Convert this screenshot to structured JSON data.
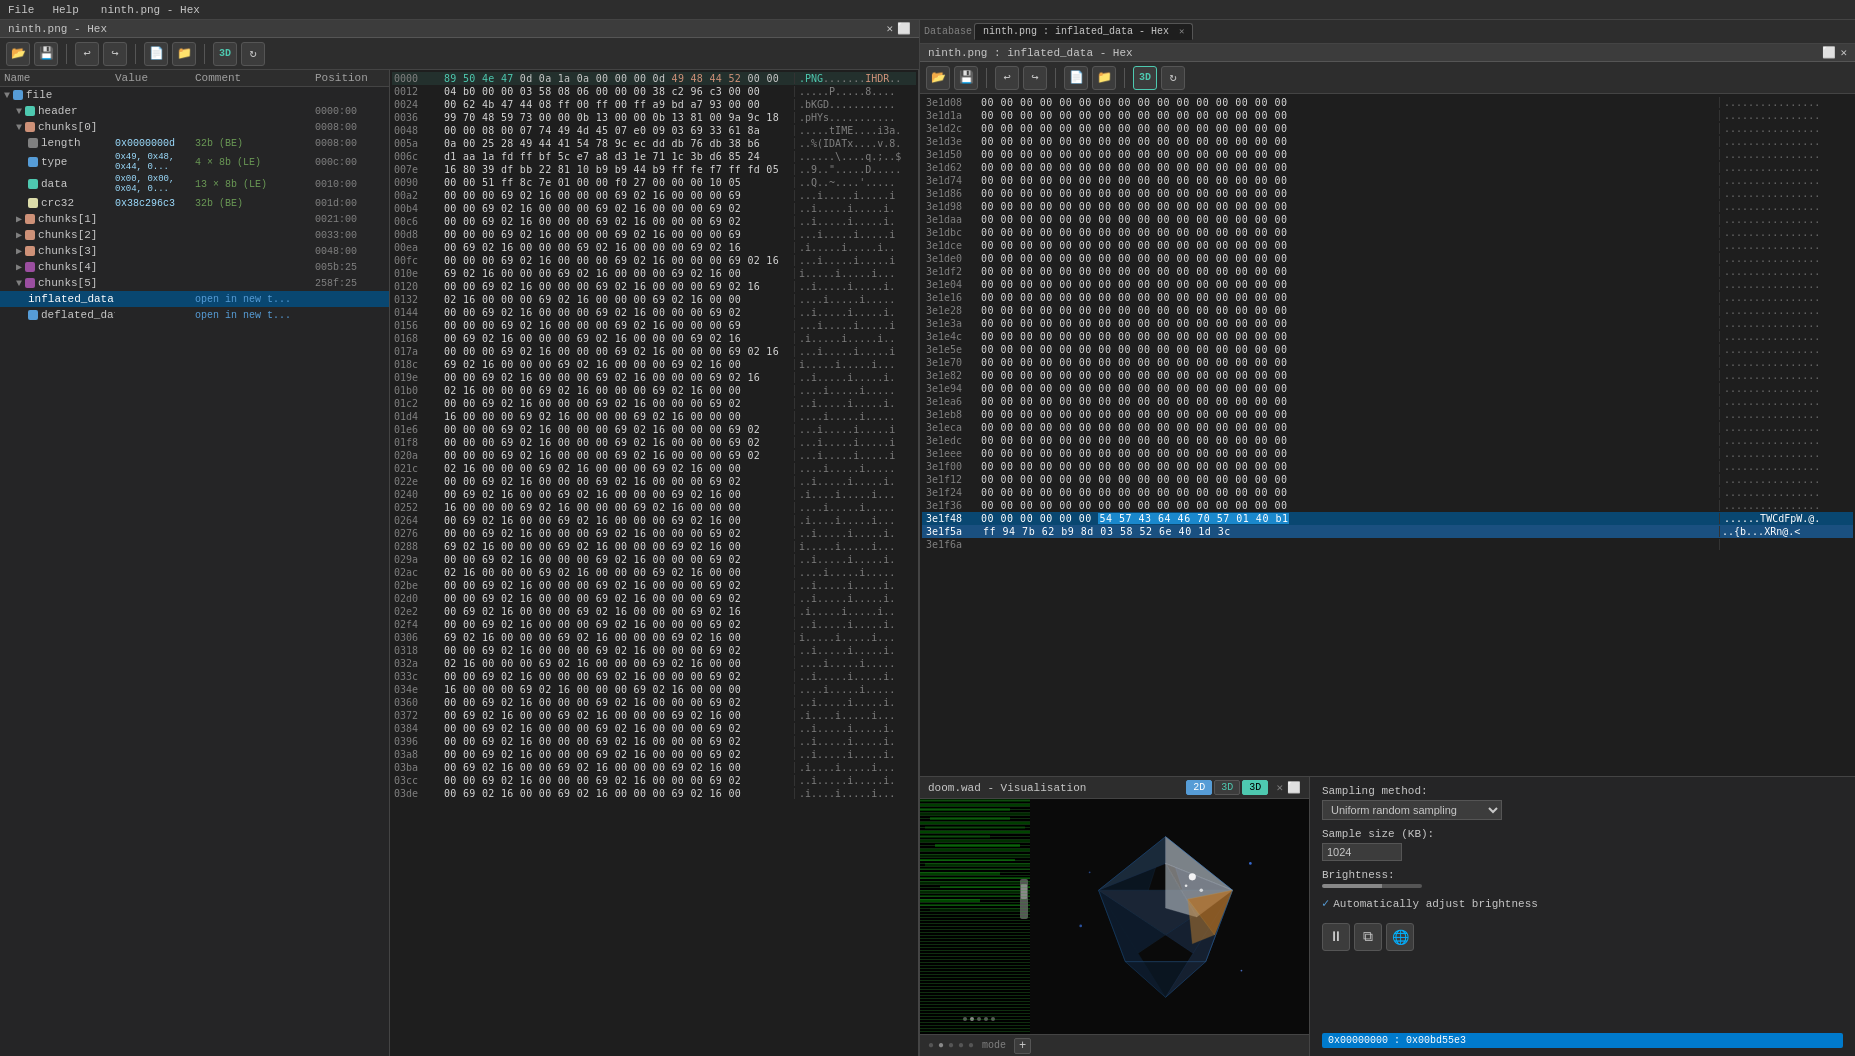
{
  "app": {
    "title": "ninth.png - Hex",
    "menu": [
      "File",
      "Help"
    ]
  },
  "main_window": {
    "title": "ninth.png - Hex",
    "tabs": [
      {
        "label": "ninth.png : inflated_data - Hex",
        "active": true,
        "closeable": true
      },
      {
        "label": "ninth.png : inflated_data - Hex",
        "active": true
      }
    ]
  },
  "toolbar": {
    "buttons": [
      "open",
      "save",
      "back",
      "forward",
      "open-file",
      "open-folder",
      "3d",
      "refresh"
    ]
  },
  "left_panel": {
    "columns": [
      "Name",
      "Value",
      "Comment",
      "Position"
    ],
    "tree": [
      {
        "indent": 0,
        "expanded": true,
        "icon": "file",
        "label": "file",
        "value": "",
        "comment": "",
        "position": ""
      },
      {
        "indent": 1,
        "expanded": true,
        "icon": "folder",
        "label": "header",
        "value": "",
        "comment": "",
        "position": "0000:00"
      },
      {
        "indent": 1,
        "expanded": true,
        "icon": "folder",
        "label": "chunks[0]",
        "value": "",
        "comment": "",
        "position": "0008:00"
      },
      {
        "indent": 2,
        "label": "length",
        "value": "0x0000000d",
        "comment": "32b (BE)",
        "position": "0008:00"
      },
      {
        "indent": 2,
        "label": "type",
        "value": "0x49, 0x48, 0x44, 0...",
        "comment": "4 × 8b (LE)",
        "position": "000c:00"
      },
      {
        "indent": 2,
        "label": "data",
        "value": "0x00, 0x00, 0x04, 0...",
        "comment": "13 × 8b (LE)",
        "position": "0010:00"
      },
      {
        "indent": 2,
        "label": "crc32",
        "value": "0x38c296c3",
        "comment": "32b (BE)",
        "position": "001d:00"
      },
      {
        "indent": 1,
        "expanded": false,
        "icon": "folder",
        "label": "chunks[1]",
        "value": "",
        "comment": "",
        "position": "0021:00"
      },
      {
        "indent": 1,
        "expanded": false,
        "icon": "folder",
        "label": "chunks[2]",
        "value": "",
        "comment": "",
        "position": "0033:00"
      },
      {
        "indent": 1,
        "expanded": false,
        "icon": "folder",
        "label": "chunks[3]",
        "value": "",
        "comment": "",
        "position": "0048:00"
      },
      {
        "indent": 1,
        "expanded": false,
        "icon": "folder",
        "label": "chunks[4]",
        "value": "",
        "comment": "",
        "position": "005b:25"
      },
      {
        "indent": 1,
        "expanded": false,
        "icon": "folder",
        "label": "chunks[5]",
        "value": "",
        "comment": "",
        "position": "258f:25"
      },
      {
        "indent": 2,
        "label": "inflated_data",
        "value": "",
        "comment": "open in new t...",
        "position": "",
        "selected": true
      },
      {
        "indent": 2,
        "label": "deflated_data",
        "value": "",
        "comment": "open in new t...",
        "position": ""
      }
    ]
  },
  "hex_panel": {
    "title": "ninth.png - Hex",
    "rows": [
      {
        "addr": "0000",
        "bytes": "89 50 4e 47 0d 0a 1a 0a 00 00 00 0d 49 48 44 52 00 00",
        "ascii": ""
      },
      {
        "addr": "0012",
        "bytes": "04 b0 00 00 03 58 08 06 00 00 00 38 c2 96 c3 00 00",
        "ascii": ""
      },
      {
        "addr": "0024",
        "bytes": "00 62 4b 47 44 08 ff 00 ff 00 ff a9 bd a7 93 00 00",
        "ascii": ""
      },
      {
        "addr": "0036",
        "bytes": "99 70 48 59 73 00 00 0b 13 00 00 0b 13 81 00 9a 9c 18",
        "ascii": ""
      },
      {
        "addr": "0048",
        "bytes": "00 00 08 00 07 74 49 4d 45 07 e0 09 03 69 33 61 8a",
        "ascii": ""
      },
      {
        "addr": "005a",
        "bytes": "0a 00 25 28 49 44 41 54 78 9c ec dd db 76 db 38 b6",
        "ascii": ""
      },
      {
        "addr": "006c",
        "bytes": "d1 aa 1a fd ff bf 5c e7 a8 d3 1e 71 1c 3b d6 85 24",
        "ascii": ""
      },
      {
        "addr": "007e",
        "bytes": "16 80 39 df bb 22 81 10 b9 b9 44 b9 ff fe f7 ff fd 05",
        "ascii": ""
      },
      {
        "addr": "0090",
        "bytes": "00 00 51 ff 8c 7e 01 00 00 f0 27 00 00 00 10 05",
        "ascii": ""
      },
      {
        "addr": "00a2",
        "bytes": "00 00 00 69 02 16 00 00 00 69 02 16 00 00 00 69",
        "ascii": ""
      },
      {
        "addr": "00b4",
        "bytes": "00 00 69 02 16 00 00 00 69 02 16 00 00 00 69 02",
        "ascii": ""
      },
      {
        "addr": "00c6",
        "bytes": "00 00 69 02 16 00 00 00 69 02 16 00 00 00 69 02",
        "ascii": ""
      },
      {
        "addr": "00d8",
        "bytes": "00 00 00 69 02 16 00 00 00 69 02 16 00 00 00 69",
        "ascii": ""
      },
      {
        "addr": "00ea",
        "bytes": "00 69 02 16 00 00 00 69 02 16 00 00 00 69 02 16",
        "ascii": ""
      },
      {
        "addr": "00fc",
        "bytes": "00 00 00 69 02 16 00 00 00 69 02 16 00 00 00 69 02 16",
        "ascii": ""
      },
      {
        "addr": "010e",
        "bytes": "69 02 16 00 00 00 69 02 16 00 00 00 69 02 16 00",
        "ascii": ""
      },
      {
        "addr": "0120",
        "bytes": "00 00 69 02 16 00 00 00 69 02 16 00 00 00 69 02 16",
        "ascii": ""
      },
      {
        "addr": "0132",
        "bytes": "02 16 00 00 00 69 02 16 00 00 00 69 02 16 00 00",
        "ascii": ""
      },
      {
        "addr": "0144",
        "bytes": "00 00 69 02 16 00 00 00 69 02 16 00 00 00 69 02",
        "ascii": ""
      },
      {
        "addr": "0156",
        "bytes": "00 00 00 69 02 16 00 00 00 69 02 16 00 00 00 69",
        "ascii": ""
      },
      {
        "addr": "0168",
        "bytes": "00 69 02 16 00 00 00 69 02 16 00 00 00 69 02 16",
        "ascii": ""
      },
      {
        "addr": "017a",
        "bytes": "00 00 00 69 02 16 00 00 00 69 02 16 00 00 00 69 02 16",
        "ascii": ""
      },
      {
        "addr": "018c",
        "bytes": "69 02 16 00 00 00 69 02 16 00 00 00 69 02 16 00",
        "ascii": ""
      },
      {
        "addr": "019e",
        "bytes": "00 00 69 02 16 00 00 00 69 02 16 00 00 00 69 02 16",
        "ascii": ""
      },
      {
        "addr": "01b0",
        "bytes": "02 16 00 00 00 69 02 16 00 00 00 69 02 16 00 00",
        "ascii": ""
      },
      {
        "addr": "01c2",
        "bytes": "00 00 69 02 16 00 00 00 69 02 16 00 00 00 69 02",
        "ascii": ""
      },
      {
        "addr": "01d4",
        "bytes": "16 00 00 00 69 02 16 00 00 00 69 02 16 00 00 00",
        "ascii": ""
      },
      {
        "addr": "01e6",
        "bytes": "00 00 00 69 02 16 00 00 00 69 02 16 00 00 00 69 02",
        "ascii": ""
      },
      {
        "addr": "01f8",
        "bytes": "00 00 00 69 02 16 00 00 00 69 02 16 00 00 00 69 02",
        "ascii": ""
      },
      {
        "addr": "020a",
        "bytes": "00 00 00 69 02 16 00 00 00 69 02 16 00 00 00 69 02",
        "ascii": ""
      },
      {
        "addr": "021c",
        "bytes": "02 16 00 00 00 69 02 16 00 00 00 69 02 16 00 00",
        "ascii": ""
      },
      {
        "addr": "022e",
        "bytes": "00 00 69 02 16 00 00 00 69 02 16 00 00 00 69 02",
        "ascii": ""
      },
      {
        "addr": "0240",
        "bytes": "00 69 02 16 00 00 69 02 16 00 00 00 69 02 16 00",
        "ascii": ""
      },
      {
        "addr": "0252",
        "bytes": "16 00 00 00 69 02 16 00 00 00 69 02 16 00 00 00",
        "ascii": ""
      },
      {
        "addr": "0264",
        "bytes": "00 69 02 16 00 00 69 02 16 00 00 00 69 02 16 00",
        "ascii": ""
      },
      {
        "addr": "0276",
        "bytes": "",
        "ascii": ""
      },
      {
        "addr": "0288",
        "bytes": "69 02 16 00 00 00 69 02 16 00 00 00 69 02 16 00",
        "ascii": ""
      },
      {
        "addr": "029a",
        "bytes": "",
        "ascii": ""
      },
      {
        "addr": "02ac",
        "bytes": "02 16 00 00 00 69 02 16 00 00 00 69 02 16 00 00",
        "ascii": ""
      },
      {
        "addr": "02be",
        "bytes": "",
        "ascii": ""
      },
      {
        "addr": "02d0",
        "bytes": "",
        "ascii": ""
      },
      {
        "addr": "02e2",
        "bytes": "00 69 02 16 00 00 00 69 02 16 00 00 00 69 02 16",
        "ascii": ""
      },
      {
        "addr": "02f4",
        "bytes": "",
        "ascii": ""
      },
      {
        "addr": "0306",
        "bytes": "69 02 16 00 00 00 69 02 16 00 00 00 69 02 16 00",
        "ascii": ""
      },
      {
        "addr": "0318",
        "bytes": "00 00 69 02 16 00 00 00 69 02 16 00 00 00 69 02",
        "ascii": ""
      },
      {
        "addr": "032a",
        "bytes": "02 16 00 00 00 69 02 16 00 00 00 69 02 16 00 00",
        "ascii": ""
      },
      {
        "addr": "033c",
        "bytes": "",
        "ascii": ""
      },
      {
        "addr": "034e",
        "bytes": "16 00 00 00 69 02 16 00 00 00 69 02 16 00 00 00",
        "ascii": ""
      },
      {
        "addr": "0360",
        "bytes": "00 00 69 02 16 00 00 00 69 02 16 00 00 00 69 02",
        "ascii": ""
      },
      {
        "addr": "0372",
        "bytes": "00 69 02 16 00 00 69 02 16 00 00 00 69 02 16 00",
        "ascii": ""
      },
      {
        "addr": "0384",
        "bytes": "",
        "ascii": ""
      },
      {
        "addr": "0396",
        "bytes": "00 00 69 02 16 00 00 00 69 02 16 00 00 00 69 02",
        "ascii": ""
      },
      {
        "addr": "03a8",
        "bytes": "",
        "ascii": ""
      },
      {
        "addr": "03ba",
        "bytes": "00 69 02 16 00 00 69 02 16 00 00 00 69 02 16 00",
        "ascii": ""
      },
      {
        "addr": "03cc",
        "bytes": "",
        "ascii": ""
      },
      {
        "addr": "03de",
        "bytes": "00 69 02 16 00 00 69 02 16 00 00 00 69 02 16 00",
        "ascii": ""
      }
    ]
  },
  "right_hex_panel": {
    "title": "ninth.png : inflated_data - Hex",
    "rows": [
      {
        "addr": "3e1d08",
        "bytes": "00 00 00 00 00 00 00 00 00 00 00 00 00 00 00 00",
        "ascii": "................"
      },
      {
        "addr": "3e1d1a",
        "bytes": "00 00 00 00 00 00 00 00 00 00 00 00 00 00 00 00",
        "ascii": "................"
      },
      {
        "addr": "3e1d2c",
        "bytes": "00 00 00 00 00 00 00 00 00 00 00 00 00 00 00 00",
        "ascii": "................"
      },
      {
        "addr": "3e1d3e",
        "bytes": "00 00 00 00 00 00 00 00 00 00 00 00 00 00 00 00",
        "ascii": "................"
      },
      {
        "addr": "3e1d50",
        "bytes": "00 00 00 00 00 00 00 00 00 00 00 00 00 00 00 00",
        "ascii": "................"
      },
      {
        "addr": "3e1d62",
        "bytes": "00 00 00 00 00 00 00 00 00 00 00 00 00 00 00 00",
        "ascii": "................"
      },
      {
        "addr": "3e1d74",
        "bytes": "00 00 00 00 00 00 00 00 00 00 00 00 00 00 00 00",
        "ascii": "................"
      },
      {
        "addr": "3e1d86",
        "bytes": "00 00 00 00 00 00 00 00 00 00 00 00 00 00 00 00",
        "ascii": "................"
      },
      {
        "addr": "3e1d98",
        "bytes": "00 00 00 00 00 00 00 00 00 00 00 00 00 00 00 00",
        "ascii": "................"
      },
      {
        "addr": "3e1daa",
        "bytes": "00 00 00 00 00 00 00 00 00 00 00 00 00 00 00 00",
        "ascii": "................"
      },
      {
        "addr": "3e1dbc",
        "bytes": "00 00 00 00 00 00 00 00 00 00 00 00 00 00 00 00",
        "ascii": "................"
      },
      {
        "addr": "3e1dce",
        "bytes": "00 00 00 00 00 00 00 00 00 00 00 00 00 00 00 00",
        "ascii": "................"
      },
      {
        "addr": "3e1de0",
        "bytes": "00 00 00 00 00 00 00 00 00 00 00 00 00 00 00 00",
        "ascii": "................"
      },
      {
        "addr": "3e1df2",
        "bytes": "00 00 00 00 00 00 00 00 00 00 00 00 00 00 00 00",
        "ascii": "................"
      },
      {
        "addr": "3e1e04",
        "bytes": "00 00 00 00 00 00 00 00 00 00 00 00 00 00 00 00",
        "ascii": "................"
      },
      {
        "addr": "3e1e16",
        "bytes": "00 00 00 00 00 00 00 00 00 00 00 00 00 00 00 00",
        "ascii": "................"
      },
      {
        "addr": "3e1e28",
        "bytes": "00 00 00 00 00 00 00 00 00 00 00 00 00 00 00 00",
        "ascii": "................"
      },
      {
        "addr": "3e1e3a",
        "bytes": "00 00 00 00 00 00 00 00 00 00 00 00 00 00 00 00",
        "ascii": "................"
      },
      {
        "addr": "3e1e4c",
        "bytes": "00 00 00 00 00 00 00 00 00 00 00 00 00 00 00 00",
        "ascii": "................"
      },
      {
        "addr": "3e1e5e",
        "bytes": "00 00 00 00 00 00 00 00 00 00 00 00 00 00 00 00",
        "ascii": "................"
      },
      {
        "addr": "3e1e70",
        "bytes": "00 00 00 00 00 00 00 00 00 00 00 00 00 00 00 00",
        "ascii": "................"
      },
      {
        "addr": "3e1e82",
        "bytes": "00 00 00 00 00 00 00 00 00 00 00 00 00 00 00 00",
        "ascii": "................"
      },
      {
        "addr": "3e1e94",
        "bytes": "00 00 00 00 00 00 00 00 00 00 00 00 00 00 00 00",
        "ascii": "................"
      },
      {
        "addr": "3e1ea6",
        "bytes": "00 00 00 00 00 00 00 00 00 00 00 00 00 00 00 00",
        "ascii": "................"
      },
      {
        "addr": "3e1eb8",
        "bytes": "00 00 00 00 00 00 00 00 00 00 00 00 00 00 00 00",
        "ascii": "................"
      },
      {
        "addr": "3e1eca",
        "bytes": "00 00 00 00 00 00 00 00 00 00 00 00 00 00 00 00",
        "ascii": "................"
      },
      {
        "addr": "3e1edc",
        "bytes": "00 00 00 00 00 00 00 00 00 00 00 00 00 00 00 00",
        "ascii": "................"
      },
      {
        "addr": "3e1eee",
        "bytes": "00 00 00 00 00 00 00 00 00 00 00 00 00 00 00 00",
        "ascii": "................"
      },
      {
        "addr": "3e1f00",
        "bytes": "00 00 00 00 00 00 00 00 00 00 00 00 00 00 00 00",
        "ascii": "................"
      },
      {
        "addr": "3e1f12",
        "bytes": "00 00 00 00 00 00 00 00 00 00 00 00 00 00 00 00",
        "ascii": "................"
      },
      {
        "addr": "3e1f24",
        "bytes": "00 00 00 00 00 00 00 00 00 00 00 00 00 00 00 00",
        "ascii": "................"
      },
      {
        "addr": "3e1f36",
        "bytes": "00 00 00 00 00 00 00 00 00 00 00 00 00 00 00 00",
        "ascii": "................"
      },
      {
        "addr": "3e1f48",
        "bytes": "00 00 00 00 00 00 54 57 43 64 46 70 57 01 40 b1",
        "ascii": "......TWCdFpW.@.",
        "selected": true
      },
      {
        "addr": "3e1f5a",
        "bytes": "ff 94 7b 62 b9 8d 03 58 52 6e 40 1d 3c",
        "ascii": "",
        "selected": true
      },
      {
        "addr": "3e1f6a",
        "bytes": "",
        "ascii": ""
      }
    ]
  },
  "visualization": {
    "title": "doom.wad - Visualisation",
    "mode_buttons": [
      "2D",
      "3D",
      "3D"
    ],
    "footer": {
      "mode_label": "mode",
      "add_button": "+"
    }
  },
  "settings": {
    "sampling_method_label": "Sampling method:",
    "sampling_method_value": "Uniform random sampling",
    "sample_size_label": "Sample size (KB):",
    "sample_size_value": "1024",
    "brightness_label": "Brightness:",
    "auto_brightness_label": "Automatically adjust brightness",
    "auto_brightness_checked": true,
    "buttons": [
      "pause",
      "copy",
      "globe"
    ],
    "status_value": "0x00000000 : 0x00bd55e3"
  }
}
